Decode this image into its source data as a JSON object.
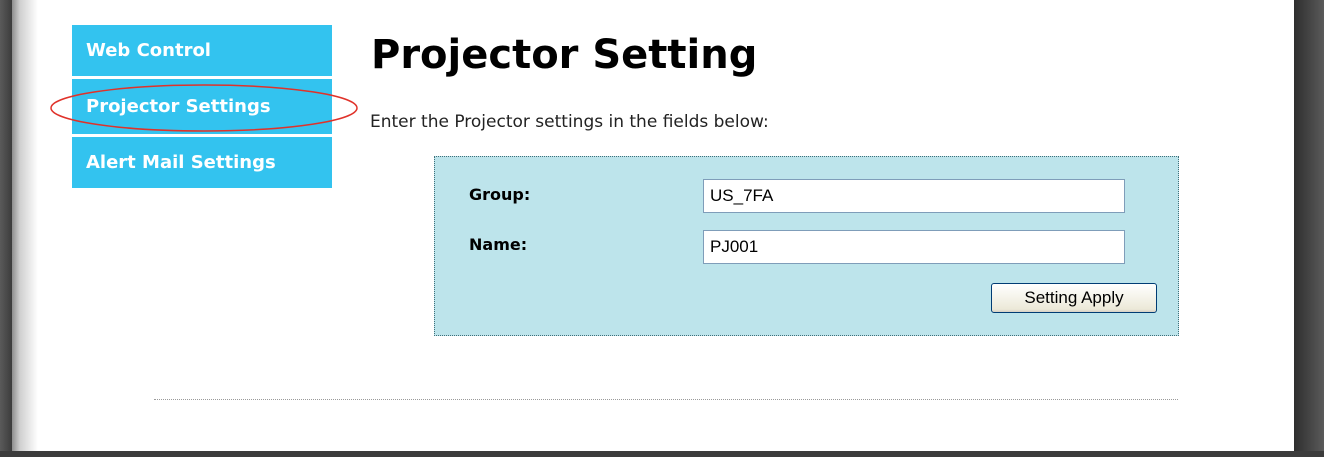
{
  "sidebar": {
    "items": [
      {
        "label": "Web Control"
      },
      {
        "label": "Projector Settings"
      },
      {
        "label": "Alert Mail Settings"
      }
    ]
  },
  "main": {
    "title": "Projector Setting",
    "instructions": "Enter the Projector settings in the fields below:",
    "form": {
      "group_label": "Group:",
      "group_value": "US_7FA",
      "name_label": "Name:",
      "name_value": "PJ001",
      "apply_label": "Setting Apply"
    }
  },
  "colors": {
    "sidebar_bg": "#33c3ef",
    "panel_bg": "#bde4eb",
    "highlight": "#e0322a"
  }
}
